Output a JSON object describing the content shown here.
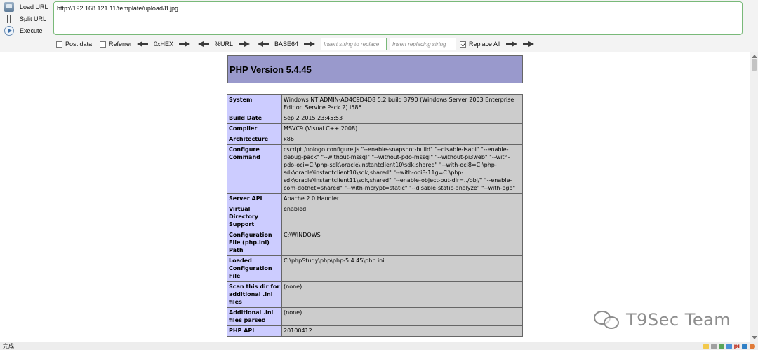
{
  "hackbar": {
    "load_url": "Load URL",
    "split_url": "Split URL",
    "execute": "Execute",
    "url": "http://192.168.121.11/template/upload/8.jpg",
    "post_data": "Post data",
    "referrer": "Referrer",
    "hex": "0xHEX",
    "url_encode": "%URL",
    "base64": "BASE64",
    "replace_placeholder": "Insert string to replace",
    "replacing_placeholder": "Insert replacing string",
    "replace_all": "Replace All",
    "replace_all_checked": true
  },
  "php": {
    "title": "PHP Version 5.4.45",
    "rows": [
      {
        "key": "System",
        "value": "Windows NT ADMIN-AD4C9D4D8 5.2 build 3790 (Windows Server 2003 Enterprise Edition Service Pack 2) i586"
      },
      {
        "key": "Build Date",
        "value": "Sep 2 2015 23:45:53"
      },
      {
        "key": "Compiler",
        "value": "MSVC9 (Visual C++ 2008)"
      },
      {
        "key": "Architecture",
        "value": "x86"
      },
      {
        "key": "Configure Command",
        "value": "cscript /nologo configure.js \"--enable-snapshot-build\" \"--disable-isapi\" \"--enable-debug-pack\" \"--without-mssql\" \"--without-pdo-mssql\" \"--without-pi3web\" \"--with-pdo-oci=C:\\php-sdk\\oracle\\instantclient10\\sdk,shared\" \"--with-oci8=C:\\php-sdk\\oracle\\instantclient10\\sdk,shared\" \"--with-oci8-11g=C:\\php-sdk\\oracle\\instantclient11\\sdk,shared\" \"--enable-object-out-dir=../obj/\" \"--enable-com-dotnet=shared\" \"--with-mcrypt=static\" \"--disable-static-analyze\" \"--with-pgo\""
      },
      {
        "key": "Server API",
        "value": "Apache 2.0 Handler"
      },
      {
        "key": "Virtual Directory Support",
        "value": "enabled"
      },
      {
        "key": "Configuration File (php.ini) Path",
        "value": "C:\\WINDOWS"
      },
      {
        "key": "Loaded Configuration File",
        "value": "C:\\phpStudy\\php\\php-5.4.45\\php.ini"
      },
      {
        "key": "Scan this dir for additional .ini files",
        "value": "(none)"
      },
      {
        "key": "Additional .ini files parsed",
        "value": "(none)"
      },
      {
        "key": "PHP API",
        "value": "20100412"
      }
    ]
  },
  "status": {
    "text": "完成",
    "tray_pi": "pi"
  },
  "watermark": {
    "text": "T9Sec Team"
  },
  "colors": {
    "php_header": "#9999cc",
    "php_key_cell": "#ccccff",
    "php_value_cell": "#cccccc",
    "hackbar_border": "#79b979"
  }
}
